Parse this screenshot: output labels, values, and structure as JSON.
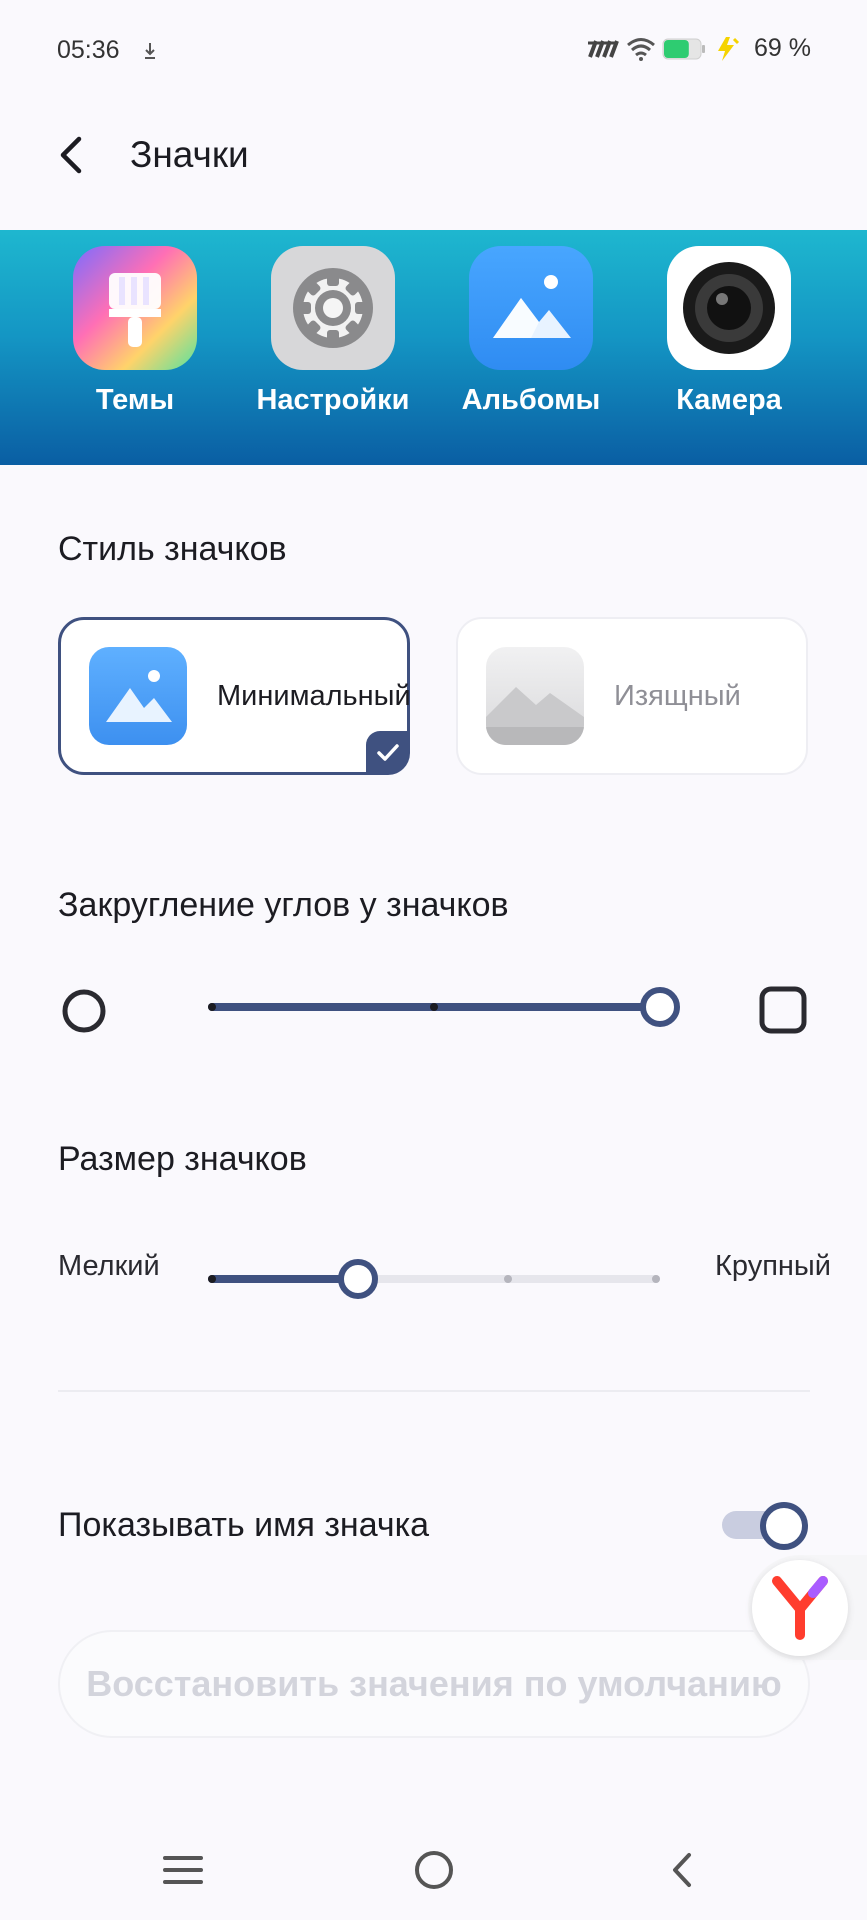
{
  "status_bar": {
    "time": "05:36",
    "battery_percent": "69 %",
    "battery_level": 0.69
  },
  "header": {
    "title": "Значки"
  },
  "preview": {
    "apps": [
      {
        "label": "Темы",
        "icon": "themes-icon"
      },
      {
        "label": "Настройки",
        "icon": "settings-gear-icon"
      },
      {
        "label": "Альбомы",
        "icon": "albums-icon"
      },
      {
        "label": "Камера",
        "icon": "camera-icon"
      }
    ]
  },
  "icon_style": {
    "title": "Стиль значков",
    "options": [
      {
        "label": "Минимальный",
        "selected": true
      },
      {
        "label": "Изящный",
        "selected": false
      }
    ]
  },
  "corner_rounding": {
    "title": "Закругление углов у значков",
    "value": 1.0,
    "steps": 3
  },
  "icon_size": {
    "title": "Размер значков",
    "min_label": "Мелкий",
    "max_label": "Крупный",
    "value": 0.33,
    "steps": 4
  },
  "show_name": {
    "label": "Показывать имя значка",
    "enabled": true
  },
  "reset_button": {
    "label": "Восстановить значения по умолчанию"
  },
  "colors": {
    "accent": "#3f5180",
    "banner_top": "#1eb7cf",
    "banner_bottom": "#0a5ea3"
  }
}
